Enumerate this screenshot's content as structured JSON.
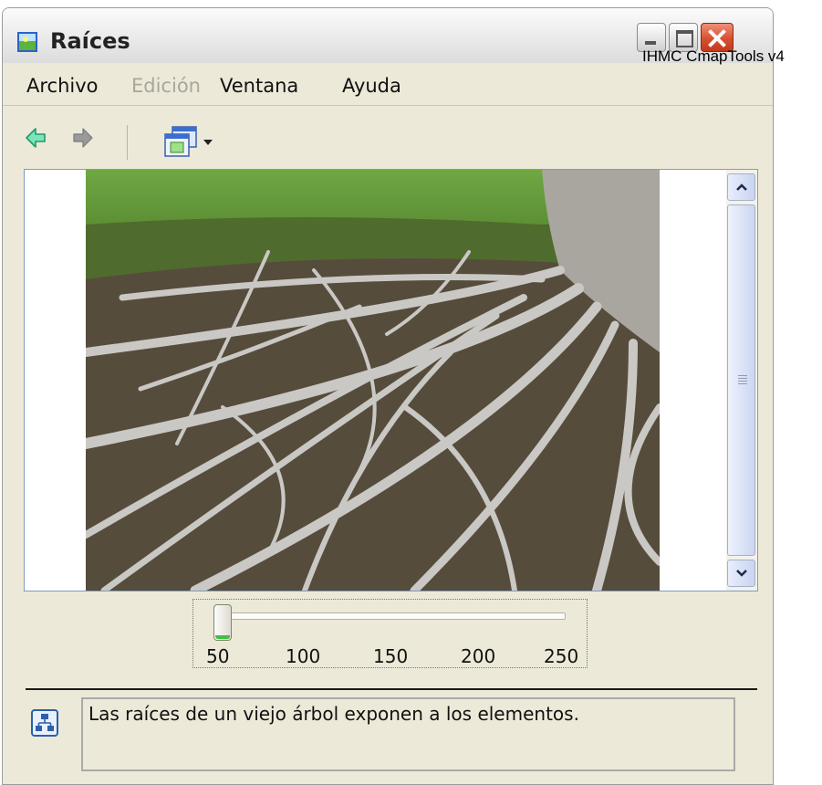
{
  "window": {
    "title": "Raíces"
  },
  "overlay_label": "IHMC CmapTools v4",
  "menu": {
    "items": [
      {
        "label": "Archivo",
        "enabled": true
      },
      {
        "label": "Edición",
        "enabled": false
      },
      {
        "label": "Ventana",
        "enabled": true
      },
      {
        "label": "Ayuda",
        "enabled": true
      }
    ]
  },
  "toolbar": {
    "back_icon": "arrow-left-icon",
    "forward_icon": "arrow-right-icon",
    "view_icon": "window-view-icon"
  },
  "viewer": {
    "image_subject": "exposed tree roots on grass"
  },
  "zoom_slider": {
    "ticks": [
      "50",
      "100",
      "150",
      "200",
      "250"
    ],
    "value": 50,
    "min": 50,
    "max": 250
  },
  "description": {
    "text": "Las raíces de un viejo árbol exponen a los elementos."
  },
  "colors": {
    "window_bg": "#ece9d8",
    "close_button": "#d65131",
    "slider_indicator": "#3fbf3f"
  }
}
